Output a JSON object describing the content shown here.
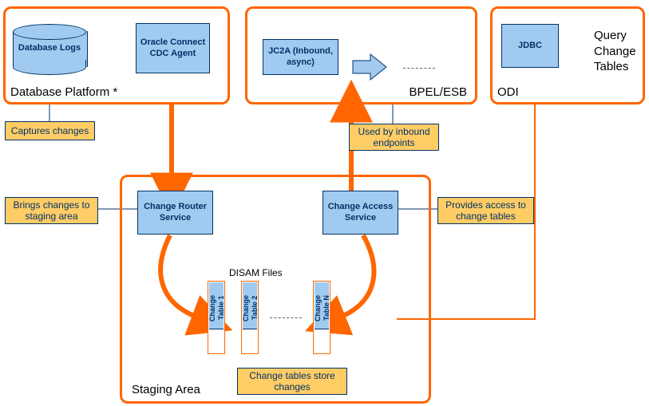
{
  "regions": {
    "database_platform": {
      "title": "Database Platform *"
    },
    "bpel_esb": {
      "title": "BPEL/ESB"
    },
    "odi": {
      "title": "ODI",
      "side_label": "Query Change Tables"
    },
    "staging": {
      "title": "Staging Area",
      "disam_label": "DISAM Files"
    }
  },
  "nodes": {
    "db_logs": "Database Logs",
    "cdc_agent": "Oracle Connect CDC Agent",
    "jc2a": "JC2A (Inbound, async)",
    "jdbc": "JDBC",
    "router": "Change Router Service",
    "access": "Change Access Service"
  },
  "notes": {
    "captures": "Captures changes",
    "brings": "Brings changes to staging area",
    "used_by": "Used by inbound endpoints",
    "provides": "Provides access to change tables",
    "store": "Change tables store changes"
  },
  "change_tables": {
    "t1": "Change Table 1",
    "t2": "Change Table 2",
    "tn": "Change Table N"
  },
  "colors": {
    "accent": "#ff6600",
    "node_fill": "#a1caf0",
    "node_border": "#003366",
    "note_fill": "#ffcc66"
  }
}
